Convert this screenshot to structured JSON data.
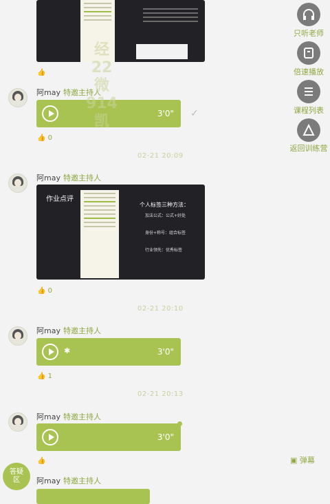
{
  "side": {
    "listen_teacher": "只听老师",
    "speed_play": "倍速播放",
    "course_list": "课程列表",
    "back_training": "返回训练营"
  },
  "float": {
    "badge": "答疑\n区",
    "danmu": "弹幕"
  },
  "messages": [
    {
      "name": "阿may",
      "role": "特邀主持人",
      "dur": "3'0\"",
      "like": "0",
      "time": "02-21 20:09"
    },
    {
      "name": "阿may",
      "role": "特邀主持人",
      "like": "0",
      "time": "02-21 20:10"
    },
    {
      "name": "阿may",
      "role": "特邀主持人",
      "dur": "3'0\"",
      "like": "1",
      "time": "02-21 20:13"
    },
    {
      "name": "阿may",
      "role": "特邀主持人",
      "dur": "3'0\""
    },
    {
      "name": "阿may",
      "role": "特邀主持人"
    }
  ],
  "card2": {
    "title": "作业点评",
    "heading": "个人标签三种方法：",
    "items": [
      "加法公式：公式+好处",
      "身份+称号：组合标签",
      "行业领先：优秀标签"
    ]
  },
  "colors": {
    "accent": "#a9c352",
    "label": "#8fa842"
  }
}
